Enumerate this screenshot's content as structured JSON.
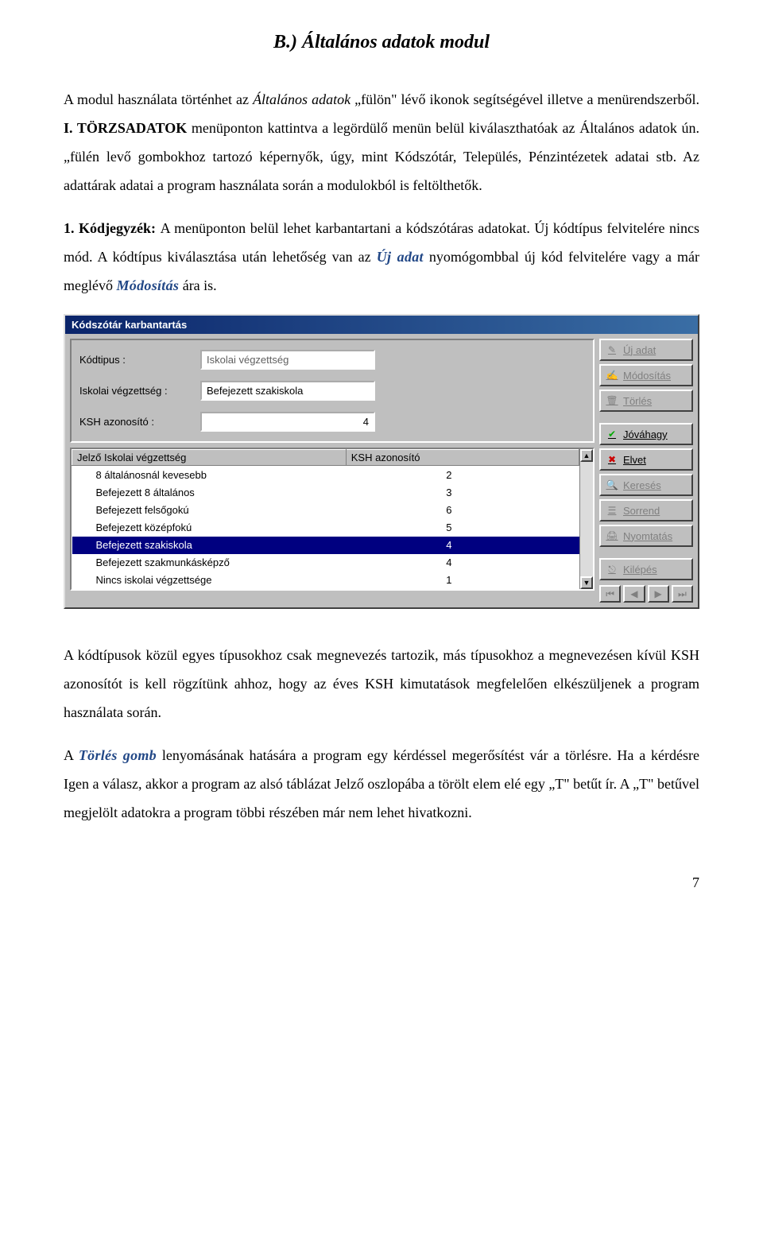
{
  "title": "B.) Általános adatok modul",
  "para1_a": "A modul használata történhet az ",
  "para1_b": "Általános adatok",
  "para1_c": " „fülön\" lévő ikonok segítségével illetve a menürendszerből. ",
  "para1_d": "I. TÖRZSADATOK",
  "para1_e": " menüponton kattintva a legördülő menün belül kiválaszthatóak az Általános adatok ún. „fülén levő gombokhoz tartozó képernyők, úgy, mint Kódszótár, Település, Pénzintézetek adatai stb. Az adattárak adatai a program használata során a modulokból is feltölthetők.",
  "para2_a": "1. Kódjegyzék: ",
  "para2_b": "A menüponton belül lehet karbantartani a kódszótáras adatokat. Új kódtípus felvitelére nincs mód. A kódtípus kiválasztása után lehetőség van az ",
  "para2_c": "Új adat",
  "para2_d": " nyomógombbal új kód felvitelére vagy a már meglévő ",
  "para2_e": "Módosítás",
  "para2_f": "ára is.",
  "window": {
    "title": "Kódszótár karbantartás",
    "labels": {
      "kodtipus": "Kódtipus :",
      "iskolai": "Iskolai végzettség :",
      "ksh": "KSH azonosító :"
    },
    "values": {
      "kodtipus": "Iskolai végzettség",
      "iskolai": "Befejezett szakiskola",
      "ksh": "4"
    },
    "table": {
      "headers": {
        "col1": "Jelző Iskolai végzettség",
        "col2": "KSH azonosító"
      },
      "rows": [
        {
          "name": "8 általánosnál kevesebb",
          "ksh": "2",
          "sel": false
        },
        {
          "name": "Befejezett 8 általános",
          "ksh": "3",
          "sel": false
        },
        {
          "name": "Befejezett felsőgokú",
          "ksh": "6",
          "sel": false
        },
        {
          "name": "Befejezett középfokú",
          "ksh": "5",
          "sel": false
        },
        {
          "name": "Befejezett szakiskola",
          "ksh": "4",
          "sel": true
        },
        {
          "name": "Befejezett szakmunkásképző",
          "ksh": "4",
          "sel": false
        },
        {
          "name": "Nincs iskolai végzettsége",
          "ksh": "1",
          "sel": false
        }
      ]
    },
    "buttons": {
      "ujadat": "Új adat",
      "modositas": "Módosítás",
      "torles": "Törlés",
      "jovahagy": "Jóváhagy",
      "elvet": "Elvet",
      "kereses": "Keresés",
      "sorrend": "Sorrend",
      "nyomtatas": "Nyomtatás",
      "kilepes": "Kilépés"
    }
  },
  "para3_a": "A kódtípusok közül egyes típusokhoz csak megnevezés tartozik, más típusokhoz a megnevezésen kívül KSH azonosítót is kell rögzítünk ahhoz, hogy az éves KSH kimutatások megfelelően elkészüljenek  a program használata során.",
  "para4_a": "A ",
  "para4_b": "Törlés gomb",
  "para4_c": " lenyomásának hatására a program egy kérdéssel megerősítést vár a törlésre. Ha a kérdésre Igen a válasz, akkor a program az alsó táblázat Jelző oszlopába a törölt elem elé egy „T\" betűt ír. A „T\" betűvel megjelölt adatokra a program többi részében már nem lehet hivatkozni.",
  "pagenum": "7"
}
